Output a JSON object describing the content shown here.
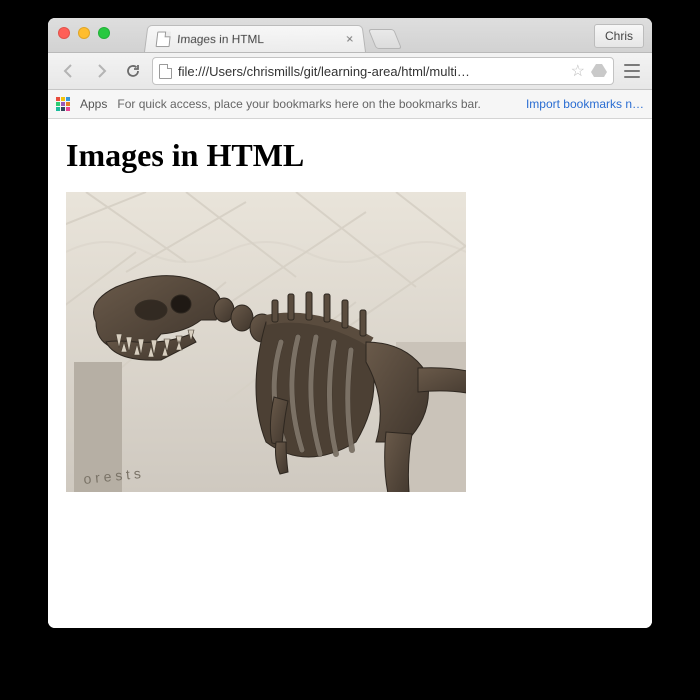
{
  "window": {
    "profile_name": "Chris"
  },
  "tab": {
    "title": "Images in HTML"
  },
  "toolbar": {
    "url": "file:///Users/chrismills/git/learning-area/html/multi…"
  },
  "bookmarks_bar": {
    "apps_label": "Apps",
    "hint": "For quick access, place your bookmarks here on the bookmarks bar.",
    "import_label": "Import bookmarks n…"
  },
  "page": {
    "heading": "Images in HTML",
    "image_alt": "dinosaur-skeleton"
  }
}
